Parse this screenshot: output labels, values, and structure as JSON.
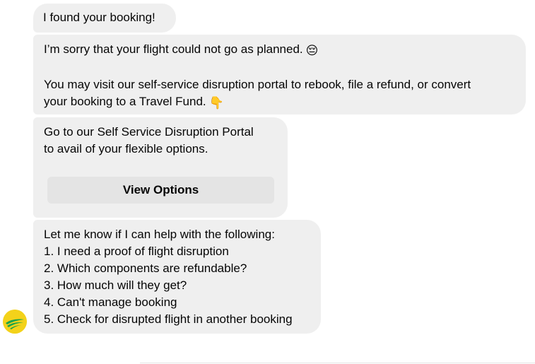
{
  "messages": {
    "m1": {
      "text": "I found your booking!"
    },
    "m2": {
      "line1": "I’m sorry that your flight could not go as planned.",
      "line1_emoji": "😔",
      "line2": "You may visit our self-service disruption portal to rebook, file a refund, or convert",
      "line3": "your booking to a Travel Fund.",
      "line3_emoji": "👇"
    },
    "m3": {
      "line1": "Go to our Self Service Disruption Portal",
      "line2": "to avail of your flexible options.",
      "button_label": "View Options"
    },
    "m4": {
      "intro": "Let me know if I can help with the following:",
      "options": [
        "1. I need a proof of flight disruption",
        "2. Which components are refundable?",
        "3. How much will they get?",
        "4. Can't manage booking",
        "5. Check for disrupted flight in another booking"
      ]
    }
  },
  "avatar": {
    "icon": "airline-logo-icon",
    "bg_color": "#f3d21a",
    "accent_color": "#1aa34a"
  },
  "colors": {
    "bubble_bg": "#efefef",
    "button_bg": "#e4e4e4",
    "text": "#050505"
  }
}
